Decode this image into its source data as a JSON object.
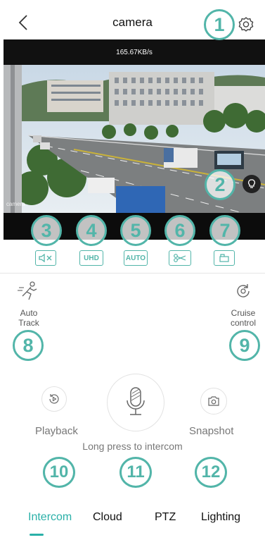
{
  "header": {
    "title": "camera"
  },
  "video": {
    "bitrate": "165.67KB/s",
    "feed_label": "camera"
  },
  "toolbar": {
    "uhd_label": "UHD",
    "auto_label": "AUTO"
  },
  "controls": {
    "auto_track": "Auto\nTrack",
    "cruise_control": "Cruise\ncontrol",
    "playback": "Playback",
    "snapshot": "Snapshot",
    "intercom_hint": "Long press to intercom"
  },
  "tabs": [
    "Intercom",
    "Cloud",
    "PTZ",
    "Lighting"
  ],
  "markers": [
    "1",
    "2",
    "3",
    "4",
    "5",
    "6",
    "7",
    "8",
    "9",
    "10",
    "11",
    "12"
  ],
  "colors": {
    "accent": "#52b5a9",
    "tab_active": "#2ab0a8"
  }
}
